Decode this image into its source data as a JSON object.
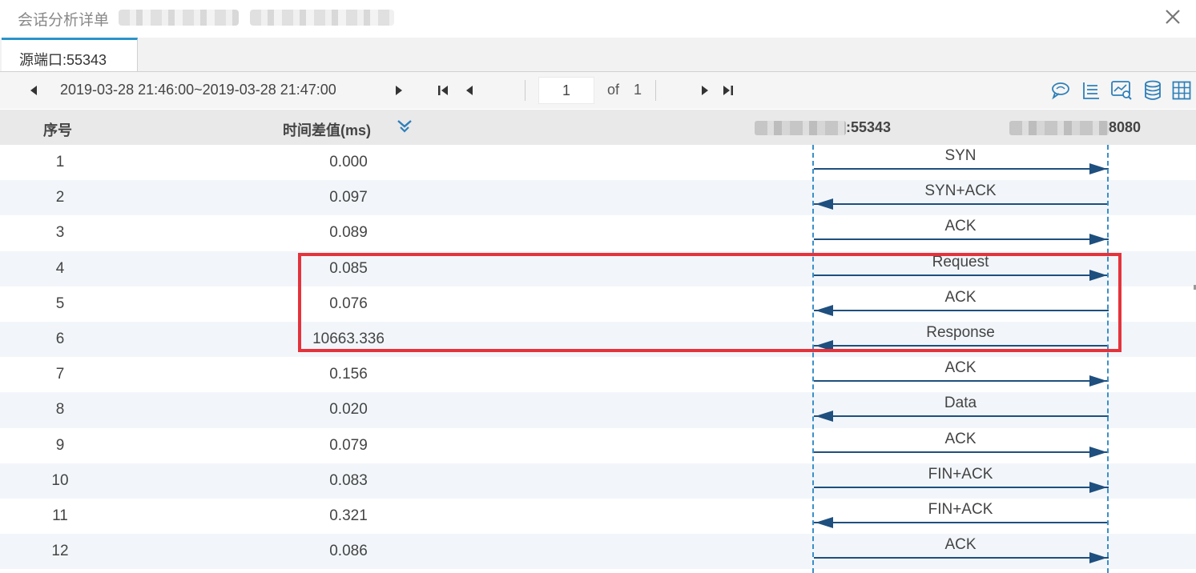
{
  "window": {
    "title": "会话分析详单",
    "close_icon": "close-icon"
  },
  "tabs": [
    {
      "label": "源端口:55343",
      "active": true
    }
  ],
  "toolbar": {
    "range": "2019-03-28 21:46:00~2019-03-28 21:47:00",
    "page_value": "1",
    "of_label": "of",
    "total_pages": "1",
    "icons": [
      "prev-range-icon",
      "next-range-icon",
      "first-page-icon",
      "prev-page-icon",
      "next-page-icon",
      "last-page-icon",
      "chat-icon",
      "list-chart-icon",
      "monitor-search-icon",
      "database-icon",
      "grid-icon"
    ]
  },
  "table": {
    "headers": {
      "seq": "序号",
      "time_diff": "时间差值(ms)",
      "source_port": ":55343",
      "dest_port": "8080"
    },
    "rows": [
      {
        "seq": "1",
        "time": "0.000",
        "label": "SYN",
        "direction": "right"
      },
      {
        "seq": "2",
        "time": "0.097",
        "label": "SYN+ACK",
        "direction": "left"
      },
      {
        "seq": "3",
        "time": "0.089",
        "label": "ACK",
        "direction": "right"
      },
      {
        "seq": "4",
        "time": "0.085",
        "label": "Request",
        "direction": "right"
      },
      {
        "seq": "5",
        "time": "0.076",
        "label": "ACK",
        "direction": "left"
      },
      {
        "seq": "6",
        "time": "10663.336",
        "label": "Response",
        "direction": "left"
      },
      {
        "seq": "7",
        "time": "0.156",
        "label": "ACK",
        "direction": "right"
      },
      {
        "seq": "8",
        "time": "0.020",
        "label": "Data",
        "direction": "left"
      },
      {
        "seq": "9",
        "time": "0.079",
        "label": "ACK",
        "direction": "right"
      },
      {
        "seq": "10",
        "time": "0.083",
        "label": "FIN+ACK",
        "direction": "right"
      },
      {
        "seq": "11",
        "time": "0.321",
        "label": "FIN+ACK",
        "direction": "left"
      },
      {
        "seq": "12",
        "time": "0.086",
        "label": "ACK",
        "direction": "right"
      }
    ]
  },
  "colors": {
    "accent": "#2b93c8",
    "arrow": "#1e4f7e",
    "lifeline": "#3a8fc8",
    "highlight": "#e5333b",
    "icon": "#2e7fb8"
  }
}
